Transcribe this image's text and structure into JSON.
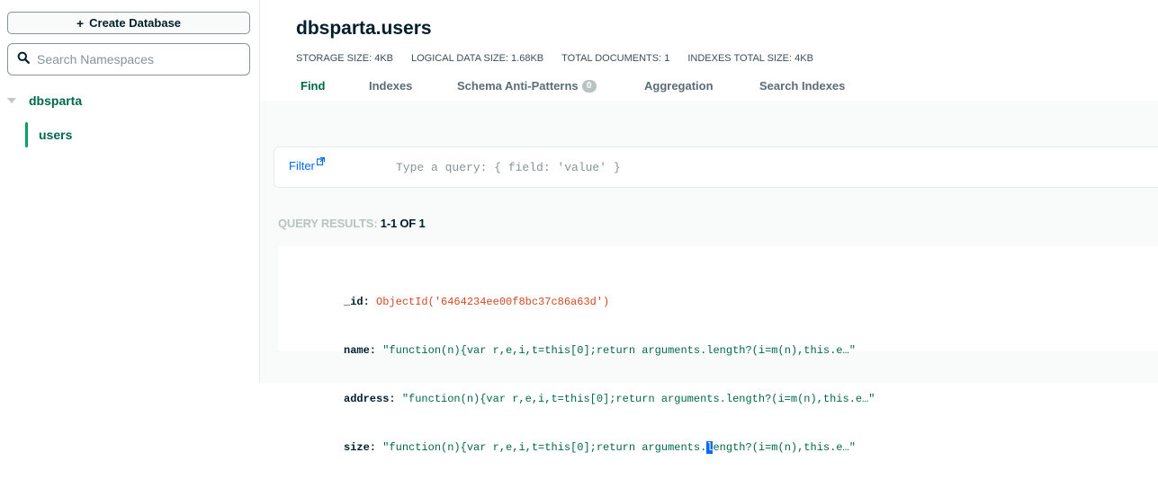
{
  "sidebar": {
    "create_button": "Create Database",
    "search_placeholder": "Search Namespaces",
    "database": "dbsparta",
    "collection": "users"
  },
  "header": {
    "title": "dbsparta.users",
    "stats": [
      "STORAGE SIZE: 4KB",
      "LOGICAL DATA SIZE: 1.68KB",
      "TOTAL DOCUMENTS: 1",
      "INDEXES TOTAL SIZE: 4KB"
    ],
    "tabs": [
      {
        "label": "Find",
        "active": true
      },
      {
        "label": "Indexes"
      },
      {
        "label": "Schema Anti-Patterns",
        "badge": "0"
      },
      {
        "label": "Aggregation"
      },
      {
        "label": "Search Indexes"
      }
    ]
  },
  "filter": {
    "label": "Filter",
    "placeholder": "Type a query: { field: 'value' }"
  },
  "results": {
    "label": "QUERY RESULTS:",
    "count": "1-1 OF 1"
  },
  "document": {
    "id_key": "_id:",
    "id_value": "ObjectId('6464234ee00f8bc37c86a63d')",
    "fields": [
      {
        "key": "name:",
        "value": "\"function(n){var r,e,i,t=this[0];return arguments.length?(i=m(n),this.e…\""
      },
      {
        "key": "address:",
        "value": "\"function(n){var r,e,i,t=this[0];return arguments.length?(i=m(n),this.e…\""
      }
    ],
    "size_key": "size:",
    "size_value_pre": "\"function(n){var r,e,i,t=this[0];return arguments.",
    "size_value_cursor": "l",
    "size_value_post": "ength?(i=m(n),this.e…\""
  },
  "colors": {
    "accent_green": "#00684a",
    "active_bar": "#00a35c",
    "link_blue": "#016bf8",
    "objectid": "#cf4a22"
  }
}
